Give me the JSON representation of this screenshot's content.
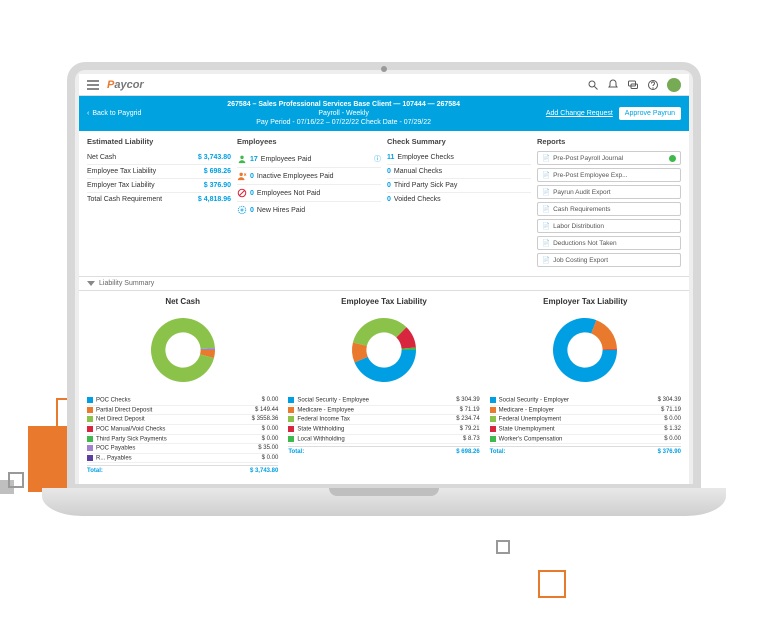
{
  "logo": {
    "p": "P",
    "rest": "aycor"
  },
  "bluebar": {
    "back": "Back to Paygrid",
    "client": "267584 – Sales Professional Services Base Client — 107444 — 267584",
    "freq": "Payroll - Weekly",
    "period": "Pay Period - 07/16/22 – 07/22/22   Check Date - 07/29/22",
    "add_change": "Add Change Request",
    "approve": "Approve Payrun"
  },
  "liability": {
    "title": "Estimated Liability",
    "rows": [
      {
        "label": "Net Cash",
        "amount": "$ 3,743.80"
      },
      {
        "label": "Employee Tax Liability",
        "amount": "$ 698.26"
      },
      {
        "label": "Employer Tax Liability",
        "amount": "$ 376.90"
      },
      {
        "label": "Total Cash Requirement",
        "amount": "$ 4,818.96"
      }
    ]
  },
  "employees": {
    "title": "Employees",
    "rows": [
      {
        "icon": "user",
        "color": "#3fb94c",
        "count": "17",
        "label": "Employees Paid",
        "info": true
      },
      {
        "icon": "user-x",
        "color": "#e8792d",
        "count": "0",
        "label": "Inactive Employees Paid"
      },
      {
        "icon": "ban",
        "color": "#d7263d",
        "count": "0",
        "label": "Employees Not Paid"
      },
      {
        "icon": "plus",
        "color": "#009fe3",
        "count": "0",
        "label": "New Hires Paid"
      }
    ]
  },
  "checks": {
    "title": "Check Summary",
    "rows": [
      {
        "count": "11",
        "label": "Employee Checks"
      },
      {
        "count": "0",
        "label": "Manual Checks"
      },
      {
        "count": "0",
        "label": "Third Party Sick Pay"
      },
      {
        "count": "0",
        "label": "Voided Checks"
      }
    ]
  },
  "reports": {
    "title": "Reports",
    "items": [
      {
        "label": "Pre-Post Payroll Journal",
        "status": true
      },
      {
        "label": "Pre-Post Employee Exp..."
      },
      {
        "label": "Payrun Audit Export"
      },
      {
        "label": "Cash Requirements"
      },
      {
        "label": "Labor Distribution"
      },
      {
        "label": "Deductions Not Taken"
      },
      {
        "label": "Job Costing Export"
      }
    ]
  },
  "summary_hdr": "Liability Summary",
  "chart_data": [
    {
      "type": "pie",
      "title": "Net Cash",
      "series": [
        {
          "name": "POC Checks",
          "value": 0.0,
          "color": "#009fe3"
        },
        {
          "name": "Partial Direct Deposit",
          "value": 149.44,
          "color": "#e8792d"
        },
        {
          "name": "Net Direct Deposit",
          "value": 3558.36,
          "color": "#8bc34a"
        },
        {
          "name": "POC Manual/Void Checks",
          "value": 0.0,
          "color": "#d7263d"
        },
        {
          "name": "Third Party Sick Payments",
          "value": 0.0,
          "color": "#3fb94c"
        },
        {
          "name": "POC Payables",
          "value": 35.0,
          "color": "#a17fd1"
        },
        {
          "name": "R... Payables",
          "value": 0.0,
          "color": "#5a3fa0"
        }
      ],
      "total": "$ 3,743.80"
    },
    {
      "type": "pie",
      "title": "Employee Tax Liability",
      "series": [
        {
          "name": "Social Security - Employee",
          "value": 304.39,
          "color": "#009fe3"
        },
        {
          "name": "Medicare - Employee",
          "value": 71.19,
          "color": "#e8792d"
        },
        {
          "name": "Federal Income Tax",
          "value": 234.74,
          "color": "#8bc34a"
        },
        {
          "name": "State Withholding",
          "value": 79.21,
          "color": "#d7263d"
        },
        {
          "name": "Local Withholding",
          "value": 8.73,
          "color": "#3fb94c"
        }
      ],
      "total": "$ 698.26"
    },
    {
      "type": "pie",
      "title": "Employer Tax Liability",
      "series": [
        {
          "name": "Social Security - Employer",
          "value": 304.39,
          "color": "#009fe3"
        },
        {
          "name": "Medicare - Employer",
          "value": 71.19,
          "color": "#e8792d"
        },
        {
          "name": "Federal Unemployment",
          "value": 0.0,
          "color": "#8bc34a"
        },
        {
          "name": "State Unemployment",
          "value": 1.32,
          "color": "#d7263d"
        },
        {
          "name": "Worker's Compensation",
          "value": 0.0,
          "color": "#3fb94c"
        }
      ],
      "total": "$ 376.90"
    }
  ]
}
